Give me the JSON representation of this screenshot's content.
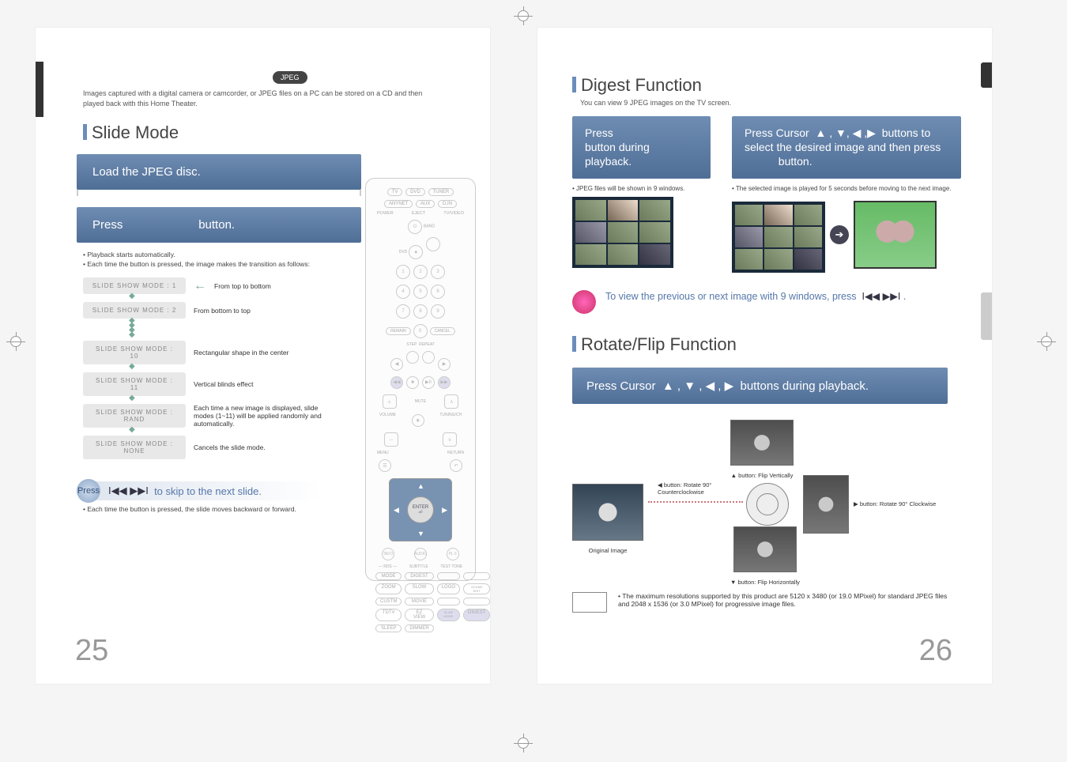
{
  "jpeg_pill": "JPEG",
  "intro": "Images captured with a digital camera or camcorder, or JPEG files on a PC can be stored on a CD and then played back with this Home Theater.",
  "slide_mode_title": "Slide Mode",
  "step1": "Load the JPEG disc.",
  "step2_a": "Press",
  "step2_b": "button.",
  "playback_notes": [
    "Playback starts automatically.",
    "Each time the button is pressed, the image makes the transition as follows:"
  ],
  "modes": [
    {
      "chip": "SLIDE SHOW MODE : 1",
      "desc": "From top to bottom"
    },
    {
      "chip": "SLIDE SHOW MODE : 2",
      "desc": "From bottom to top"
    },
    {
      "chip": "SLIDE SHOW MODE : 10",
      "desc": "Rectangular shape in the center"
    },
    {
      "chip": "SLIDE SHOW MODE : 11",
      "desc": "Vertical blinds effect"
    },
    {
      "chip": "SLIDE SHOW MODE : RAND",
      "desc": "Each time a new image is displayed, slide modes (1~11) will be applied randomly and automatically."
    },
    {
      "chip": "SLIDE SHOW MODE : NONE",
      "desc": "Cancels the slide mode."
    }
  ],
  "skip_label_a": "Press",
  "skip_label_b": "to skip to the next slide.",
  "skip_note": "Each time the button is pressed, the slide moves backward or forward.",
  "page_left": "25",
  "page_right": "26",
  "remote": {
    "top": [
      "TV",
      "DVD",
      "TUNER",
      "ANYNET",
      "AUX",
      "D.IN"
    ],
    "power": "POWER",
    "eject": "EJECT",
    "tvvideo": "TV/VIDEO",
    "nums": [
      "1",
      "2",
      "3",
      "4",
      "5",
      "6",
      "7",
      "8",
      "9",
      "0"
    ],
    "remain": "REMAIN",
    "cancel": "CANCEL",
    "step": "STEP",
    "repeat": "REPEAT",
    "mute": "MUTE",
    "volume": "VOLUME",
    "tuning": "TUNING/CH",
    "menu": "MENU",
    "return": "RETURN",
    "enter": "ENTER",
    "info": "INFO",
    "audio": "AUDIO",
    "pl": "PL II",
    "bottom": [
      "MODE",
      "DIGEST",
      "ZOOM",
      "SLOW",
      "LOGO",
      "SOUND EDIT",
      "CUSTM",
      "MOVIE",
      "",
      "",
      "TDTV",
      "EZ VIEW",
      "SLIDE MODE",
      "DIGEST",
      "SLEEP",
      "DIMMER"
    ]
  },
  "digest_title": "Digest Function",
  "digest_sub": "You can view 9 JPEG images on the TV screen.",
  "digest_step1_a": "Press",
  "digest_step1_b": "button during playback.",
  "digest_step1_note": "JPEG files will be shown in 9 windows.",
  "digest_step2_a": "Press Cursor",
  "digest_step2_b": "buttons to select the desired image and then press",
  "digest_step2_c": "button.",
  "digest_step2_note": "The selected image is played for 5 seconds before moving to the next image.",
  "tip_text_a": "To view the previous or next image with 9 windows, press",
  "rotate_title": "Rotate/Flip Function",
  "rotate_header_a": "Press Cursor",
  "rotate_header_b": "buttons during playback.",
  "orig_label": "Original Image",
  "rot_top": "▲ button: Flip Vertically",
  "rot_bottom": "▼ button: Flip Horizontally",
  "rot_left_a": "◀ button: Rotate 90°",
  "rot_left_b": "Counterclockwise",
  "rot_right": "▶ button: Rotate 90° Clockwise",
  "max_res": "The maximum resolutions supported by this product are 5120 x 3480 (or 19.0 MPixel) for standard JPEG files and 2048 x 1536 (or 3.0 MPixel) for progressive image files."
}
